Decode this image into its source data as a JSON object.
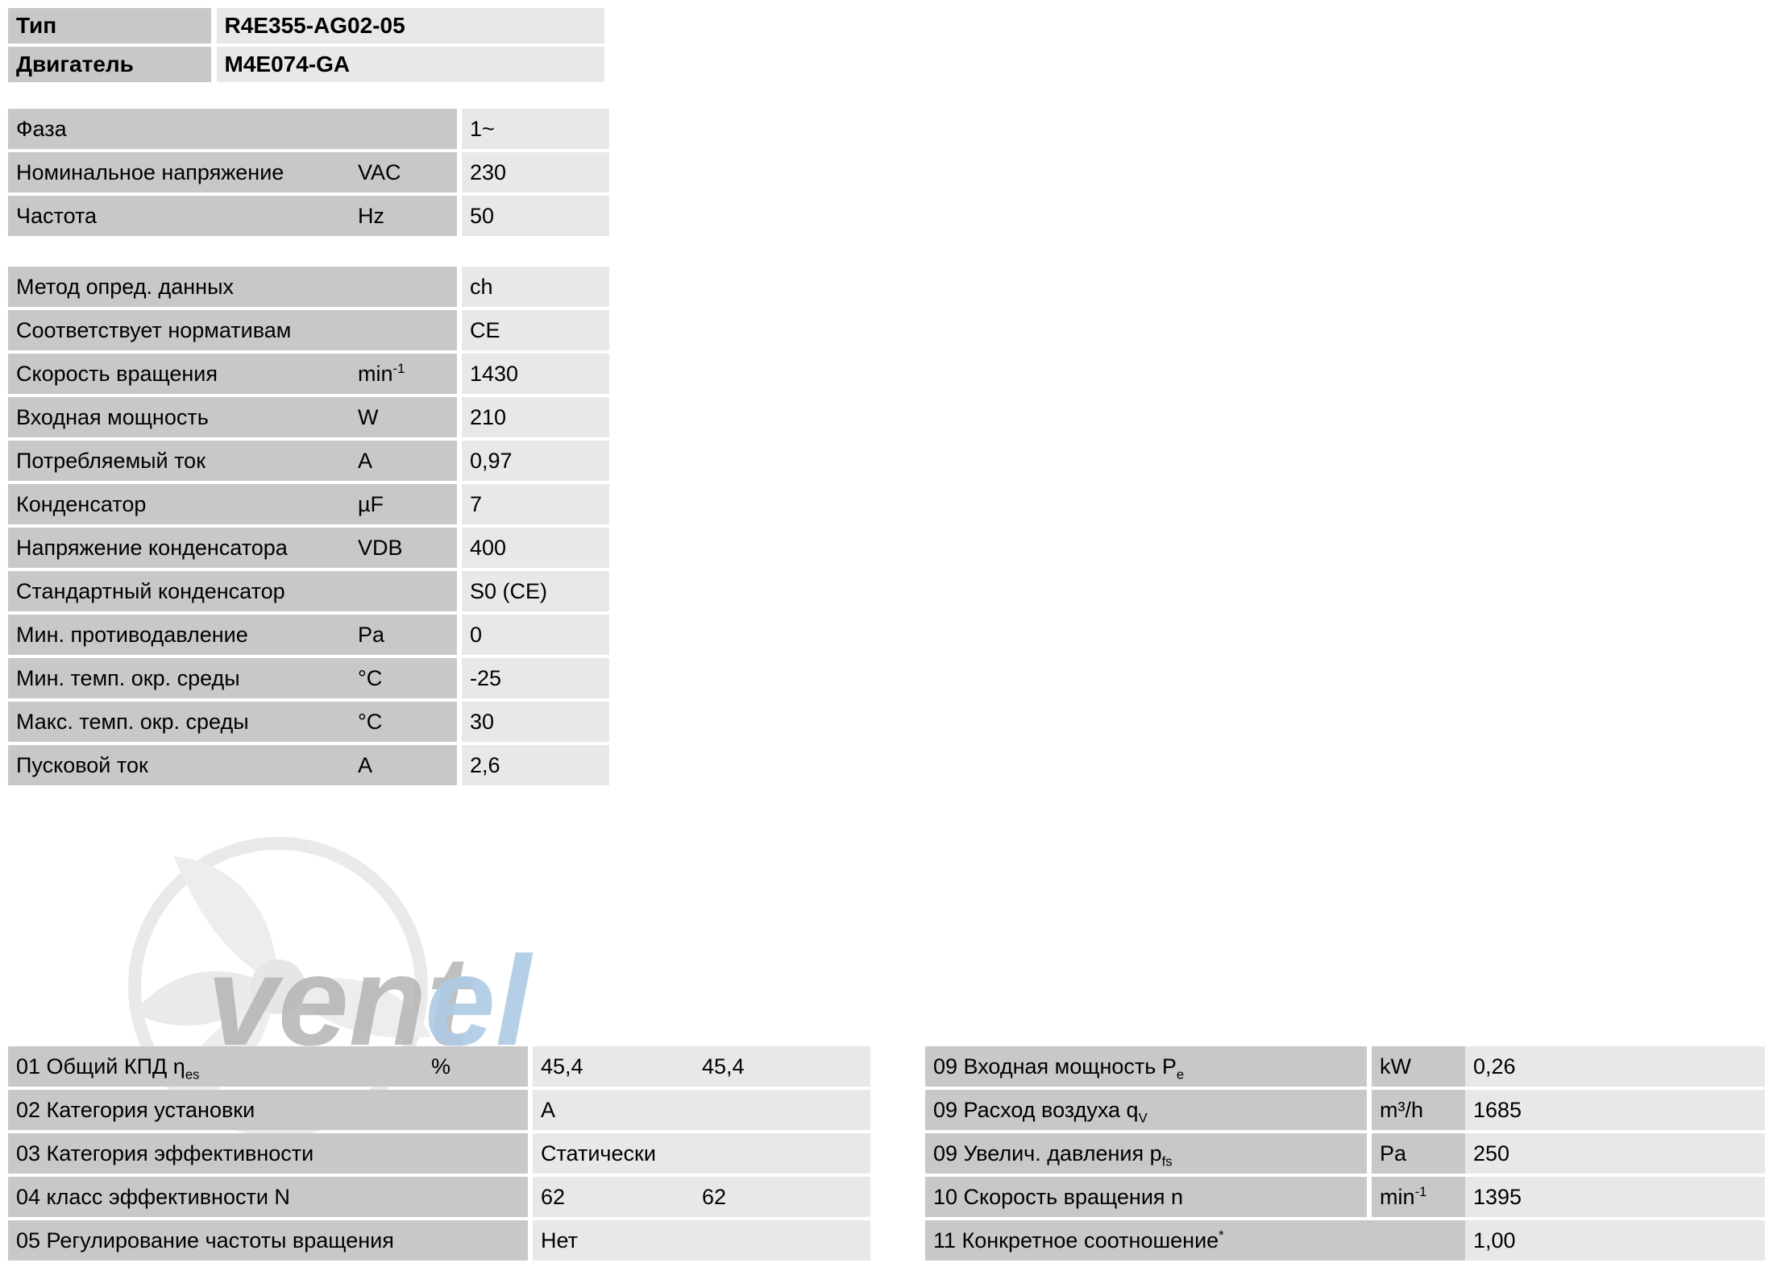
{
  "identification": {
    "rows": [
      {
        "label": "Тип",
        "value": "R4E355-AG02-05"
      },
      {
        "label": "Двигатель",
        "value": "M4E074-GA"
      }
    ]
  },
  "electrical": {
    "rows": [
      {
        "label": "Фаза",
        "unit": "",
        "value": "1~"
      },
      {
        "label": "Номинальное напряжение",
        "unit": "VAC",
        "value": "230"
      },
      {
        "label": "Частота",
        "unit": "Hz",
        "value": "50"
      }
    ]
  },
  "technical_data": {
    "rows": [
      {
        "label": "Метод опред. данных",
        "unit": "",
        "value": "ch"
      },
      {
        "label": "Соответствует нормативам",
        "unit": "",
        "value": "CE"
      },
      {
        "label": "Скорость вращения",
        "unit": "min-1",
        "unit_base": "min",
        "unit_sup": "-1",
        "value": "1430"
      },
      {
        "label": "Входная мощность",
        "unit": "W",
        "value": "210"
      },
      {
        "label": "Потребляемый ток",
        "unit": "A",
        "value": "0,97"
      },
      {
        "label": "Конденсатор",
        "unit": "µF",
        "value": "7"
      },
      {
        "label": "Напряжение конденсатора",
        "unit": "VDB",
        "value": "400"
      },
      {
        "label": "Стандартный конденсатор",
        "unit": "",
        "value": "S0 (CE)"
      },
      {
        "label": "Мин. противодавление",
        "unit": "Pa",
        "value": "0"
      },
      {
        "label": "Мин. темп. окр. среды",
        "unit": "°C",
        "value": "-25"
      },
      {
        "label": "Макс. темп. окр. среды",
        "unit": "°C",
        "value": "30"
      },
      {
        "label": "Пусковой ток",
        "unit": "A",
        "value": "2,6"
      }
    ]
  },
  "erp_left": {
    "rows": [
      {
        "label_base": "01 Общий КПД η",
        "label_sub": "es",
        "label": "01 Общий КПД ηes",
        "unit": "%",
        "value1": "45,4",
        "value2": "45,4"
      },
      {
        "label": "02 Категория установки",
        "unit": "",
        "value1": "A",
        "value2": ""
      },
      {
        "label": "03 Категория эффективности",
        "unit": "",
        "value1": "Статически",
        "value2": ""
      },
      {
        "label": "04 класс эффективности N",
        "unit": "",
        "value1": "62",
        "value2": "62"
      },
      {
        "label": "05 Регулирование частоты вращения",
        "unit": "",
        "value1": "Нет",
        "value2": ""
      }
    ]
  },
  "erp_right": {
    "rows": [
      {
        "label_base": "09 Входная мощность P",
        "label_sub": "e",
        "label": "09 Входная мощность Pe",
        "unit": "kW",
        "value": "0,26"
      },
      {
        "label_base": "09 Расход воздуха q",
        "label_sub": "V",
        "label": "09 Расход воздуха qV",
        "unit": "m³/h",
        "value": "1685"
      },
      {
        "label_base": "09 Увелич. давления p",
        "label_sub": "fs",
        "label": "09 Увелич. давления pfs",
        "unit": "Pa",
        "value": "250"
      },
      {
        "label": "10 Скорость вращения n",
        "unit_base": "min",
        "unit_sup": "-1",
        "unit": "min-1",
        "value": "1395"
      },
      {
        "label_base": "11 Конкретное соотношение",
        "label_sup": "*",
        "label": "11 Конкретное соотношение*",
        "unit": "",
        "value": "1,00"
      }
    ]
  },
  "watermark": {
    "text_part1": "vent",
    "text_part2": "el",
    "color_gray": "#b4b4b4",
    "color_blue": "#aecbe4"
  },
  "colors": {
    "label_bg": "#c8c8c8",
    "value_bg": "#e8e8e8",
    "page_bg": "#ffffff",
    "text": "#000000"
  }
}
